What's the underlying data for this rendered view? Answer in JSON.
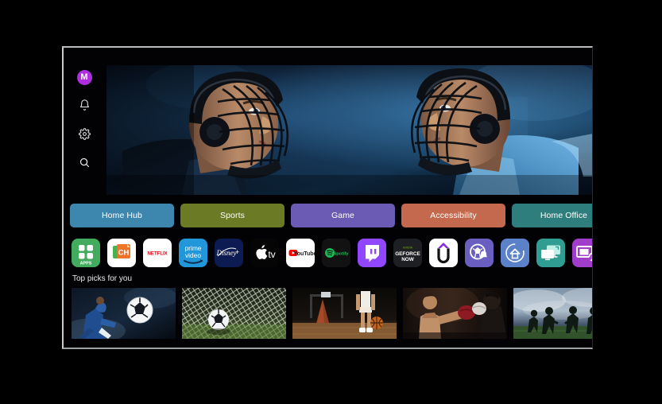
{
  "device": {
    "name": "smart-tv",
    "screen_label": "TV Home Screen"
  },
  "sidebar": {
    "avatar": {
      "initial": "M",
      "color": "#b02ee0",
      "name": "profile-avatar"
    },
    "items": [
      {
        "icon": "bell-icon",
        "label": "Notifications"
      },
      {
        "icon": "gear-icon",
        "label": "Settings"
      },
      {
        "icon": "search-icon",
        "label": "Search"
      }
    ]
  },
  "hero": {
    "name": "hero-banner",
    "description": "Two ice hockey players in cage helmets facing off"
  },
  "tabs": [
    {
      "label": "Home Hub",
      "color": "#3d86ad"
    },
    {
      "label": "Sports",
      "color": "#6b7a25"
    },
    {
      "label": "Game",
      "color": "#6b5bb5"
    },
    {
      "label": "Accessibility",
      "color": "#c4694d"
    },
    {
      "label": "Home Office",
      "color": "#2f7e7e"
    }
  ],
  "apps": [
    {
      "name": "apps-grid",
      "label": "APPS",
      "bg": "#43ab5e"
    },
    {
      "name": "ch-app",
      "label": "CH",
      "bg": "#ffffff"
    },
    {
      "name": "netflix",
      "label": "NETFLIX",
      "bg": "#ffffff"
    },
    {
      "name": "prime-video",
      "label": "prime video",
      "bg": "#2196d9"
    },
    {
      "name": "disney-plus",
      "label": "Disney+",
      "bg": "#0c1b51"
    },
    {
      "name": "apple-tv",
      "label": "tv",
      "bg": "#050505"
    },
    {
      "name": "youtube",
      "label": "YouTube",
      "bg": "#ffffff"
    },
    {
      "name": "spotify",
      "label": "Spotify",
      "bg": "#121212"
    },
    {
      "name": "twitch",
      "label": "Twitch",
      "bg": "#9146ff"
    },
    {
      "name": "geforce-now",
      "label": "GEFORCE NOW",
      "bg": "#1d1f22"
    },
    {
      "name": "u-app",
      "label": "U",
      "bg": "#ffffff"
    },
    {
      "name": "sports-alerts",
      "label": "Sports Alerts",
      "bg": "#6a5fc0"
    },
    {
      "name": "smartthings",
      "label": "SmartThings",
      "bg": "#5b82c9"
    },
    {
      "name": "screen-share",
      "label": "Screen Share",
      "bg": "#2f9d92"
    },
    {
      "name": "multi-view",
      "label": "Multi View",
      "bg": "#a03ecb"
    }
  ],
  "picks": {
    "title": "Top picks for you",
    "items": [
      {
        "name": "pick-soccer-kick",
        "label": "Soccer player striking a ball"
      },
      {
        "name": "pick-soccer-goal",
        "label": "Soccer ball in the goal net"
      },
      {
        "name": "pick-basketball",
        "label": "Basketball player dribbling indoors"
      },
      {
        "name": "pick-boxing",
        "label": "Two boxers in a match"
      },
      {
        "name": "pick-football",
        "label": "American football players on field"
      }
    ]
  }
}
